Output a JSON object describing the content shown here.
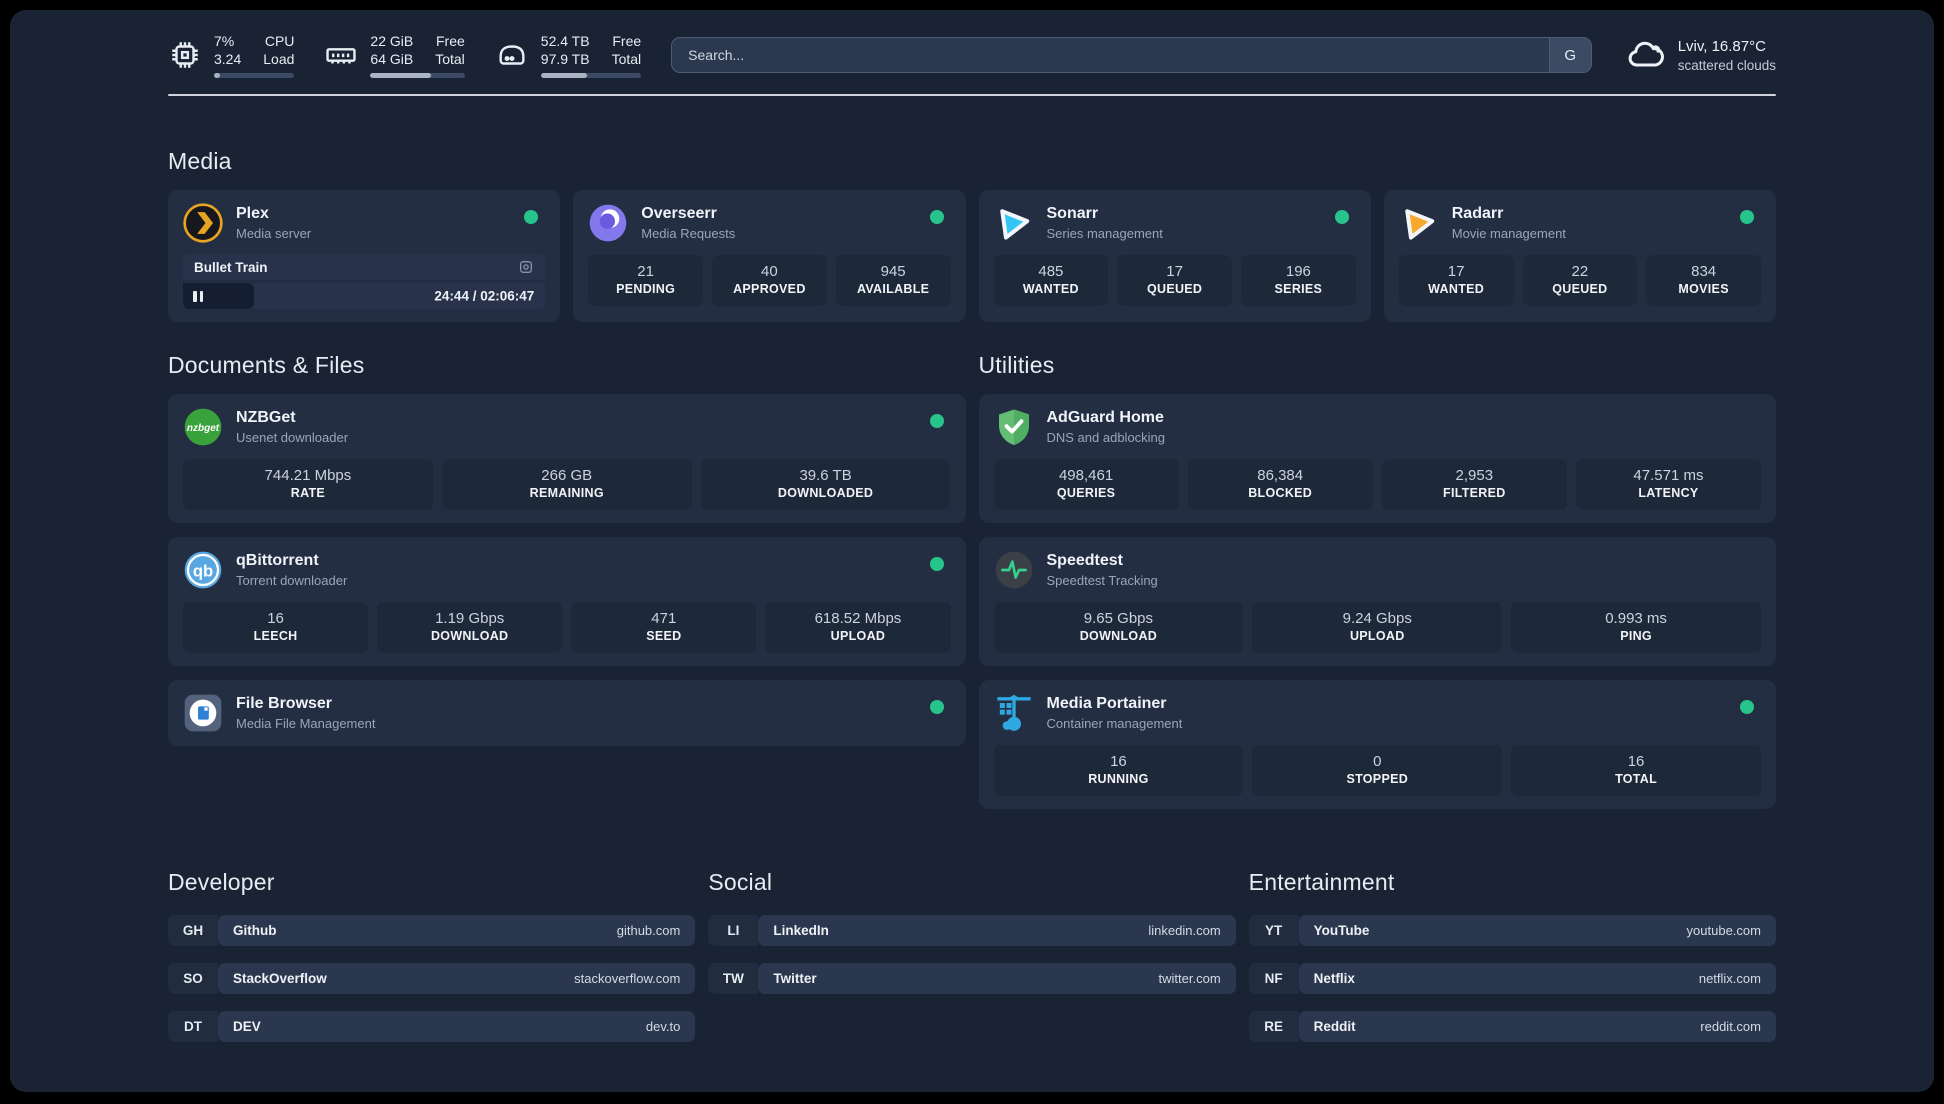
{
  "topbar": {
    "cpu": {
      "v1": "7%",
      "v2": "3.24",
      "l1": "CPU",
      "l2": "Load",
      "pct": 7
    },
    "ram": {
      "v1": "22 GiB",
      "v2": "64 GiB",
      "l1": "Free",
      "l2": "Total",
      "pct": 64
    },
    "disk": {
      "v1": "52.4 TB",
      "v2": "97.9 TB",
      "l1": "Free",
      "l2": "Total",
      "pct": 46
    },
    "search": {
      "placeholder": "Search...",
      "button_label": "G"
    },
    "weather": {
      "line1": "Lviv, 16.87°C",
      "line2": "scattered clouds"
    }
  },
  "sections": {
    "media": "Media",
    "documents": "Documents & Files",
    "utilities": "Utilities",
    "developer": "Developer",
    "social": "Social",
    "entertainment": "Entertainment"
  },
  "media": {
    "plex": {
      "name": "Plex",
      "desc": "Media server",
      "player": {
        "title": "Bullet Train",
        "time": "24:44 / 02:06:47",
        "pct": 19.5
      }
    },
    "overseerr": {
      "name": "Overseerr",
      "desc": "Media Requests",
      "stats": [
        {
          "v": "21",
          "l": "PENDING"
        },
        {
          "v": "40",
          "l": "APPROVED"
        },
        {
          "v": "945",
          "l": "AVAILABLE"
        }
      ]
    },
    "sonarr": {
      "name": "Sonarr",
      "desc": "Series management",
      "stats": [
        {
          "v": "485",
          "l": "WANTED"
        },
        {
          "v": "17",
          "l": "QUEUED"
        },
        {
          "v": "196",
          "l": "SERIES"
        }
      ]
    },
    "radarr": {
      "name": "Radarr",
      "desc": "Movie management",
      "stats": [
        {
          "v": "17",
          "l": "WANTED"
        },
        {
          "v": "22",
          "l": "QUEUED"
        },
        {
          "v": "834",
          "l": "MOVIES"
        }
      ]
    }
  },
  "documents": {
    "nzbget": {
      "name": "NZBGet",
      "desc": "Usenet downloader",
      "icon_text": "nzbget",
      "stats": [
        {
          "v": "744.21 Mbps",
          "l": "RATE"
        },
        {
          "v": "266 GB",
          "l": "REMAINING"
        },
        {
          "v": "39.6 TB",
          "l": "DOWNLOADED"
        }
      ]
    },
    "qbittorrent": {
      "name": "qBittorrent",
      "desc": "Torrent downloader",
      "icon_text": "qb",
      "stats": [
        {
          "v": "16",
          "l": "LEECH"
        },
        {
          "v": "1.19 Gbps",
          "l": "DOWNLOAD"
        },
        {
          "v": "471",
          "l": "SEED"
        },
        {
          "v": "618.52 Mbps",
          "l": "UPLOAD"
        }
      ]
    },
    "filebrowser": {
      "name": "File Browser",
      "desc": "Media File Management"
    }
  },
  "utilities": {
    "adguard": {
      "name": "AdGuard Home",
      "desc": "DNS and adblocking",
      "stats": [
        {
          "v": "498,461",
          "l": "QUERIES"
        },
        {
          "v": "86,384",
          "l": "BLOCKED"
        },
        {
          "v": "2,953",
          "l": "FILTERED"
        },
        {
          "v": "47.571 ms",
          "l": "LATENCY"
        }
      ]
    },
    "speedtest": {
      "name": "Speedtest",
      "desc": "Speedtest Tracking",
      "stats": [
        {
          "v": "9.65 Gbps",
          "l": "DOWNLOAD"
        },
        {
          "v": "9.24 Gbps",
          "l": "UPLOAD"
        },
        {
          "v": "0.993 ms",
          "l": "PING"
        }
      ]
    },
    "portainer": {
      "name": "Media Portainer",
      "desc": "Container management",
      "stats": [
        {
          "v": "16",
          "l": "RUNNING"
        },
        {
          "v": "0",
          "l": "STOPPED"
        },
        {
          "v": "16",
          "l": "TOTAL"
        }
      ]
    }
  },
  "bookmarks": {
    "developer": [
      {
        "tag": "GH",
        "name": "Github",
        "url": "github.com"
      },
      {
        "tag": "SO",
        "name": "StackOverflow",
        "url": "stackoverflow.com"
      },
      {
        "tag": "DT",
        "name": "DEV",
        "url": "dev.to"
      }
    ],
    "social": [
      {
        "tag": "LI",
        "name": "LinkedIn",
        "url": "linkedin.com"
      },
      {
        "tag": "TW",
        "name": "Twitter",
        "url": "twitter.com"
      }
    ],
    "entertainment": [
      {
        "tag": "YT",
        "name": "YouTube",
        "url": "youtube.com"
      },
      {
        "tag": "NF",
        "name": "Netflix",
        "url": "netflix.com"
      },
      {
        "tag": "RE",
        "name": "Reddit",
        "url": "reddit.com"
      }
    ]
  },
  "colors": {
    "online_dot": "#27c48b"
  }
}
